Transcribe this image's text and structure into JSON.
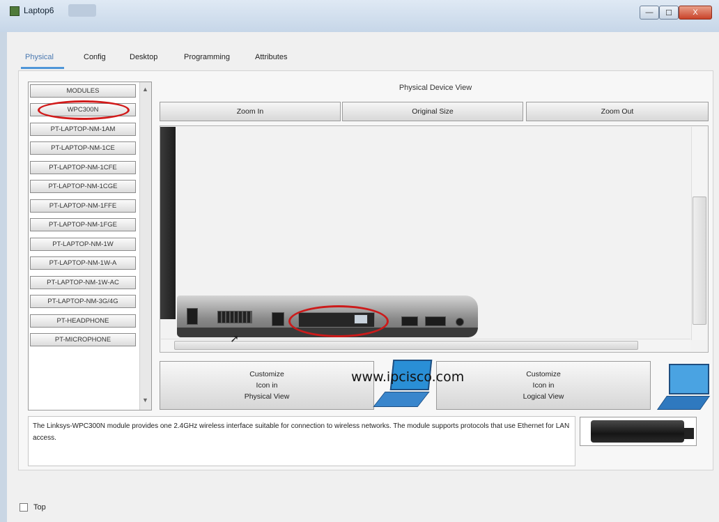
{
  "window": {
    "title": "Laptop6"
  },
  "window_controls": {
    "minimize": "—",
    "maximize": "☐",
    "close": "X"
  },
  "tabs": [
    {
      "label": "Physical",
      "active": true
    },
    {
      "label": "Config"
    },
    {
      "label": "Desktop"
    },
    {
      "label": "Programming"
    },
    {
      "label": "Attributes"
    }
  ],
  "modules": {
    "items": [
      "MODULES",
      "WPC300N",
      "PT-LAPTOP-NM-1AM",
      "PT-LAPTOP-NM-1CE",
      "PT-LAPTOP-NM-1CFE",
      "PT-LAPTOP-NM-1CGE",
      "PT-LAPTOP-NM-1FFE",
      "PT-LAPTOP-NM-1FGE",
      "PT-LAPTOP-NM-1W",
      "PT-LAPTOP-NM-1W-A",
      "PT-LAPTOP-NM-1W-AC",
      "PT-LAPTOP-NM-3G/4G",
      "PT-HEADPHONE",
      "PT-MICROPHONE"
    ],
    "highlighted": "WPC300N"
  },
  "physical_view": {
    "title": "Physical Device View",
    "zoom_in": "Zoom In",
    "original_size": "Original Size",
    "zoom_out": "Zoom Out"
  },
  "customize": {
    "physical": [
      "Customize",
      "Icon in",
      "Physical View"
    ],
    "logical": [
      "Customize",
      "Icon in",
      "Logical View"
    ]
  },
  "watermark": "www.ipcisco.com",
  "description": "The Linksys-WPC300N module provides one 2.4GHz wireless interface suitable for connection to wireless networks. The module supports protocols that use Ethernet for LAN access.",
  "bottom": {
    "top_label": "Top",
    "top_checked": false
  },
  "colors": {
    "highlight": "#d11a1a",
    "active_tab": "#4f96d8",
    "laptop_icon": "#2a8fd6"
  }
}
